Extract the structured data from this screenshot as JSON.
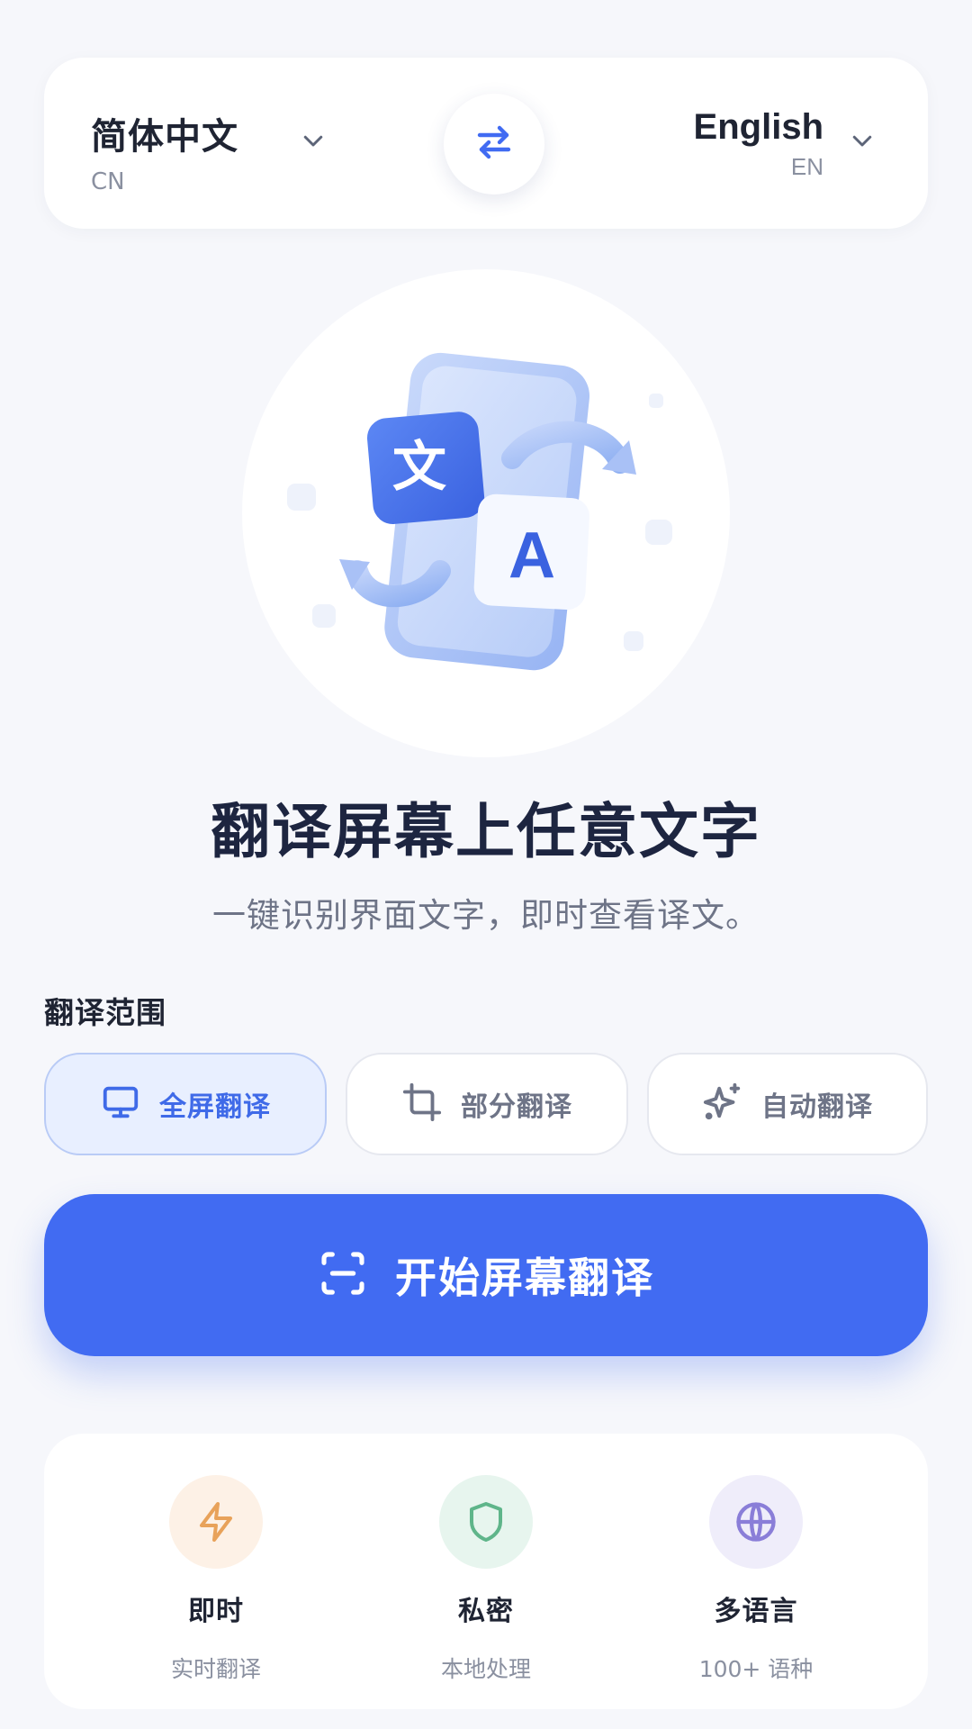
{
  "language_bar": {
    "source": {
      "name": "简体中文",
      "code": "CN"
    },
    "target": {
      "name": "English",
      "code": "EN"
    },
    "swap_icon": "swap-arrows-icon"
  },
  "hero": {
    "illustration": "phone-translate-illustration",
    "card_glyph_source": "文",
    "card_glyph_target": "A",
    "title": "翻译屏幕上任意文字",
    "subtitle": "一键识别界面文字，即时查看译文。"
  },
  "scope": {
    "label": "翻译范围",
    "modes": [
      {
        "label": "全屏翻译",
        "icon": "monitor-icon",
        "active": true
      },
      {
        "label": "部分翻译",
        "icon": "crop-icon",
        "active": false
      },
      {
        "label": "自动翻译",
        "icon": "sparkles-icon",
        "active": false
      }
    ]
  },
  "primary_button": {
    "label": "开始屏幕翻译",
    "icon": "scan-icon"
  },
  "features": [
    {
      "title": "即时",
      "subtitle": "实时翻译",
      "icon": "lightning-icon",
      "color": "#e8a25a",
      "bg": "#fdf1e6"
    },
    {
      "title": "私密",
      "subtitle": "本地处理",
      "icon": "shield-icon",
      "color": "#5fb58a",
      "bg": "#e7f5ee"
    },
    {
      "title": "多语言",
      "subtitle": "100+ 语种",
      "icon": "globe-icon",
      "color": "#8a7ed8",
      "bg": "#efedfa"
    }
  ],
  "colors": {
    "accent": "#416bf2",
    "background": "#f6f7fb",
    "active_tab_bg": "#e8efff"
  }
}
